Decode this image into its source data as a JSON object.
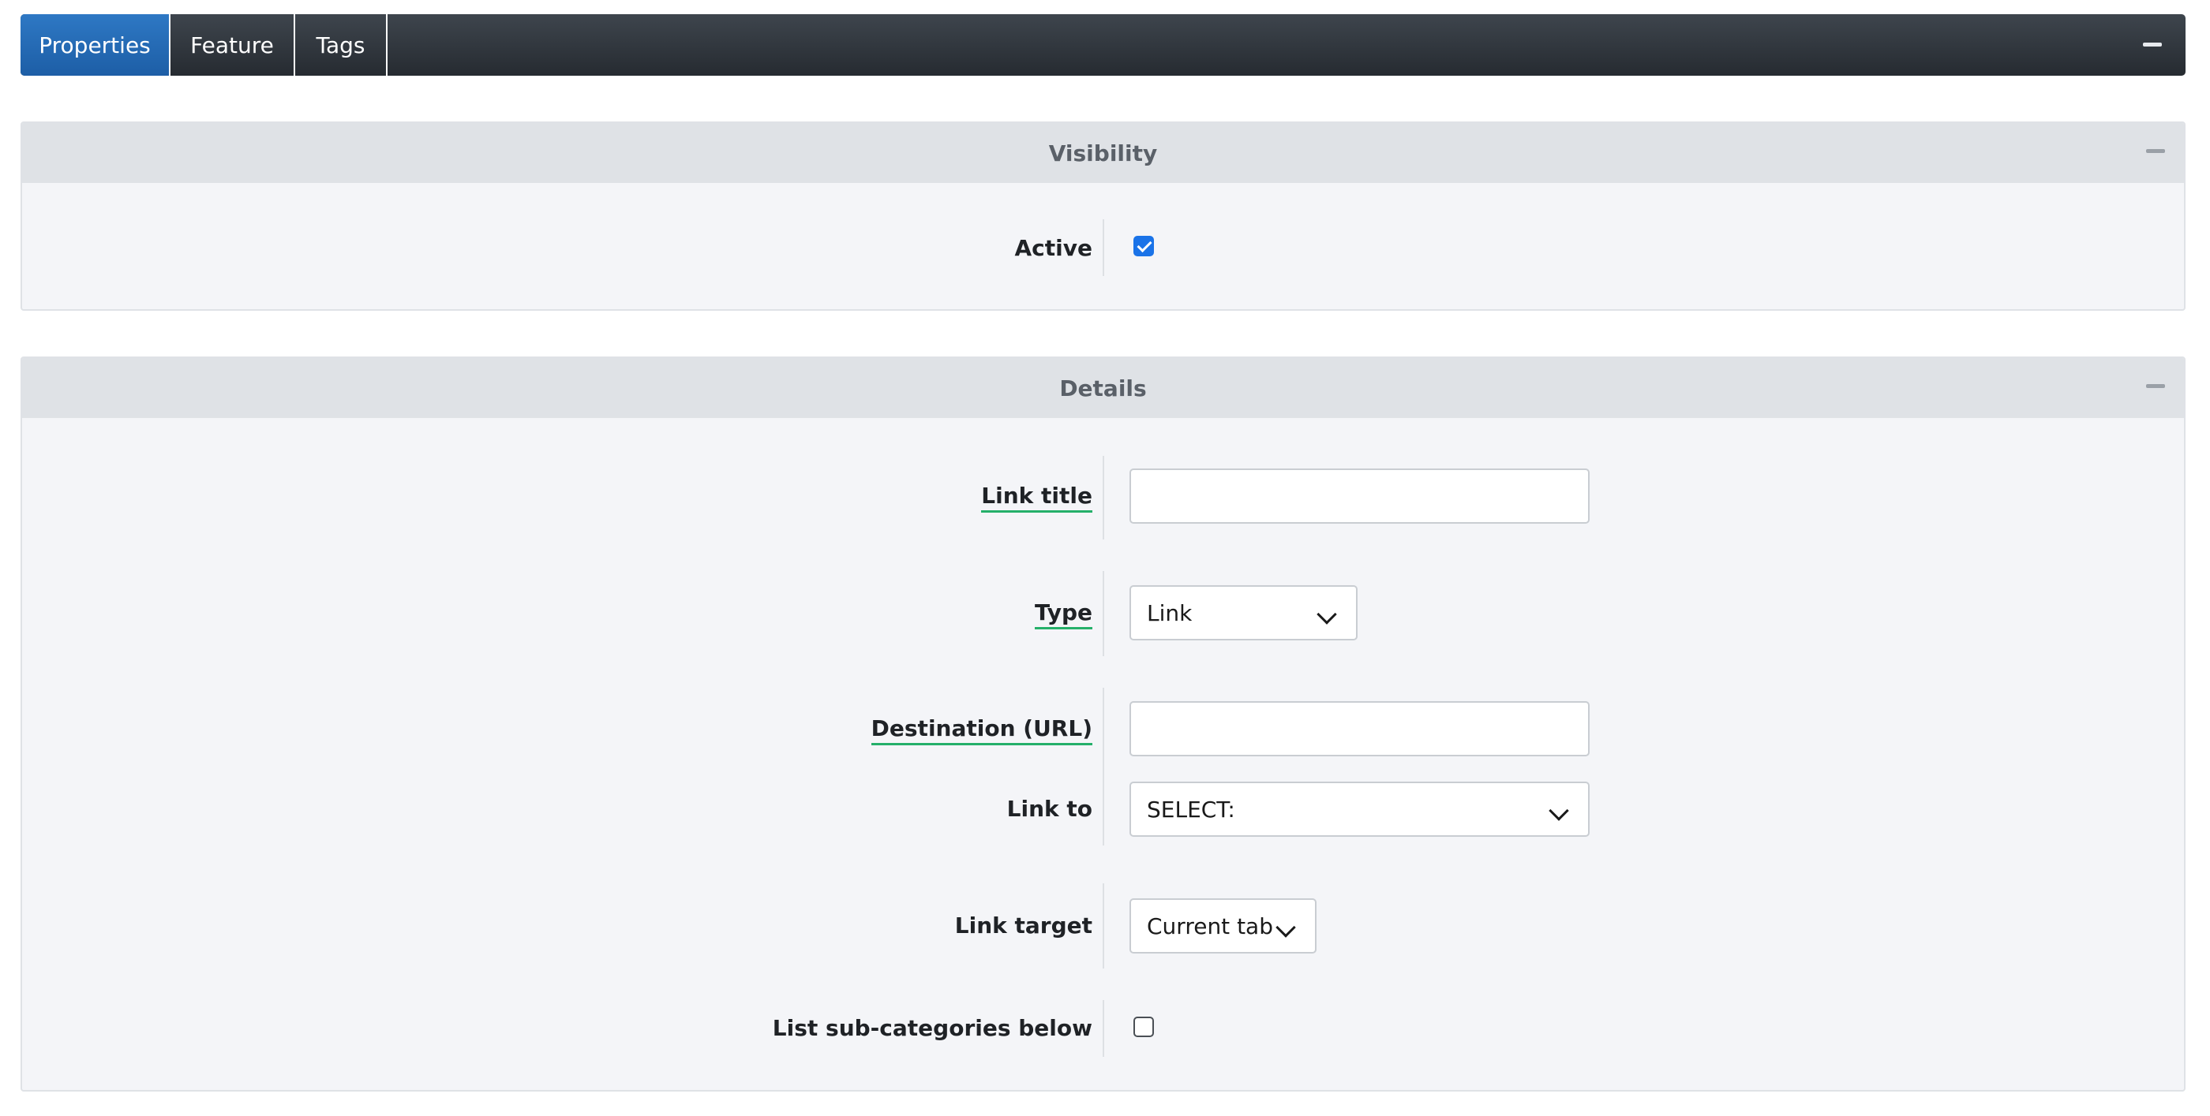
{
  "tabs": [
    {
      "label": "Properties",
      "active": true
    },
    {
      "label": "Feature",
      "active": false
    },
    {
      "label": "Tags",
      "active": false
    }
  ],
  "collapse_icon": "minus-icon",
  "visibility": {
    "title": "Visibility",
    "active_label": "Active",
    "active_checked": true
  },
  "details": {
    "title": "Details",
    "link_title_label": "Link title",
    "link_title_value": "",
    "type_label": "Type",
    "type_value": "Link",
    "destination_label": "Destination (URL)",
    "destination_value": "",
    "link_to_label": "Link to",
    "link_to_value": "SELECT:",
    "link_target_label": "Link target",
    "link_target_value": "Current tab",
    "subcategories_label": "List sub-categories below",
    "subcategories_checked": false
  },
  "colors": {
    "active_tab": "#1d5ea6",
    "tabbar": "#2f353b",
    "required_underline": "#25b06a",
    "checkbox_checked": "#1a73e8"
  }
}
